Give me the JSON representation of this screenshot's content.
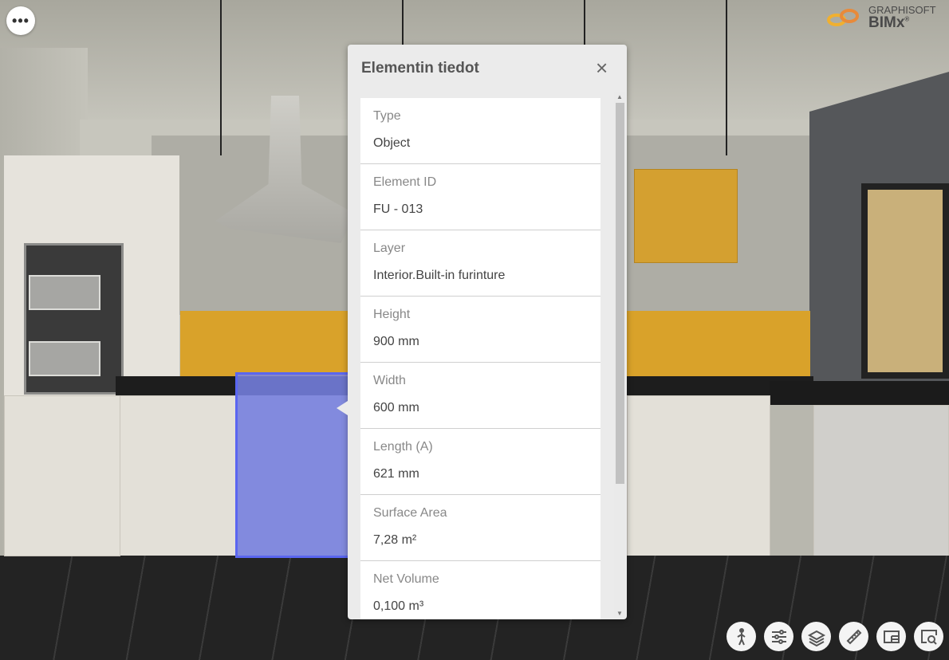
{
  "logo": {
    "line1": "GRAPHISOFT",
    "line2": "BIMx",
    "mark": "®"
  },
  "menu_button": {
    "icon": "more-dots-icon",
    "label": "•••"
  },
  "panel": {
    "title": "Elementin tiedot",
    "close_icon": "×",
    "properties": [
      {
        "label": "Type",
        "value": "Object"
      },
      {
        "label": "Element ID",
        "value": "FU - 013"
      },
      {
        "label": "Layer",
        "value": "Interior.Built-in furinture"
      },
      {
        "label": "Height",
        "value": "900 mm"
      },
      {
        "label": "Width",
        "value": "600 mm"
      },
      {
        "label": "Length (A)",
        "value": "621 mm"
      },
      {
        "label": "Surface Area",
        "value": "7,28 m²"
      },
      {
        "label": "Net Volume",
        "value": "0,100 m³"
      }
    ]
  },
  "toolbar": [
    "walk-icon",
    "settings-sliders-icon",
    "layers-icon",
    "measure-ruler-icon",
    "floorplan-icon",
    "zoom-view-icon"
  ],
  "colors": {
    "selection": "#5a66f0",
    "accent": "#d9a22a"
  }
}
